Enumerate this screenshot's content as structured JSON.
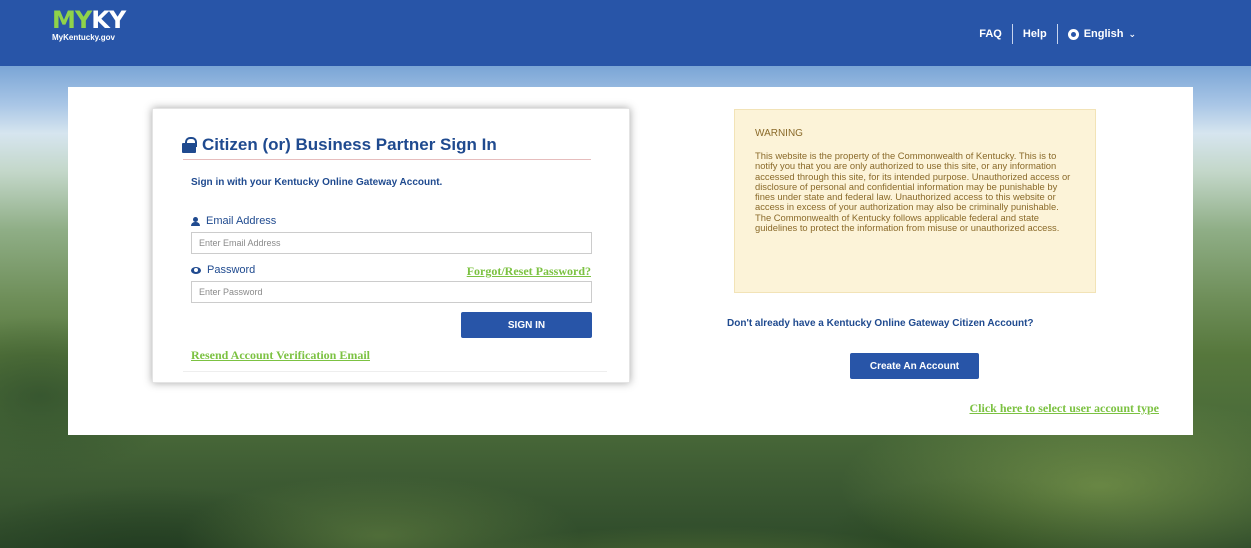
{
  "logo": {
    "main_my": "MY",
    "main_ky": "KY",
    "sub": "MyKentucky.gov"
  },
  "header_nav": {
    "faq": "FAQ",
    "help": "Help",
    "language": "English",
    "globe_icon": "globe-icon",
    "chevron_icon": "chevron-down-icon"
  },
  "colors": {
    "brand_blue": "#2855a8",
    "link_green": "#7cc242",
    "title_blue": "#1f4a8f",
    "warning_bg": "#fcf3d8"
  },
  "signin": {
    "title": "Citizen (or) Business Partner Sign In",
    "title_icon": "lock-icon",
    "subtitle": "Sign in with your Kentucky Online Gateway Account.",
    "email_label": "Email Address",
    "email_icon": "user-icon",
    "email_placeholder": "Enter Email Address",
    "email_value": "",
    "password_label": "Password",
    "password_icon": "eye-icon",
    "password_placeholder": "Enter Password",
    "password_value": "",
    "forgot_link": "Forgot/Reset Password?",
    "signin_button": "SIGN IN",
    "resend_link": "Resend Account Verification Email"
  },
  "warning": {
    "title": "WARNING",
    "text": "This website is the property of the Commonwealth of Kentucky. This is to notify you that you are only authorized to use this site, or any information accessed through this site, for its intended purpose. Unauthorized access or disclosure of personal and confidential information may be punishable by fines under state and federal law. Unauthorized access to this website or access in excess of your authorization may also be criminally punishable. The Commonwealth of Kentucky follows applicable federal and state guidelines to protect the information from misuse or unauthorized access."
  },
  "register": {
    "prompt": "Don't already have a Kentucky Online Gateway Citizen Account?",
    "create_button": "Create An Account",
    "select_type_link": "Click here to select user account type"
  }
}
